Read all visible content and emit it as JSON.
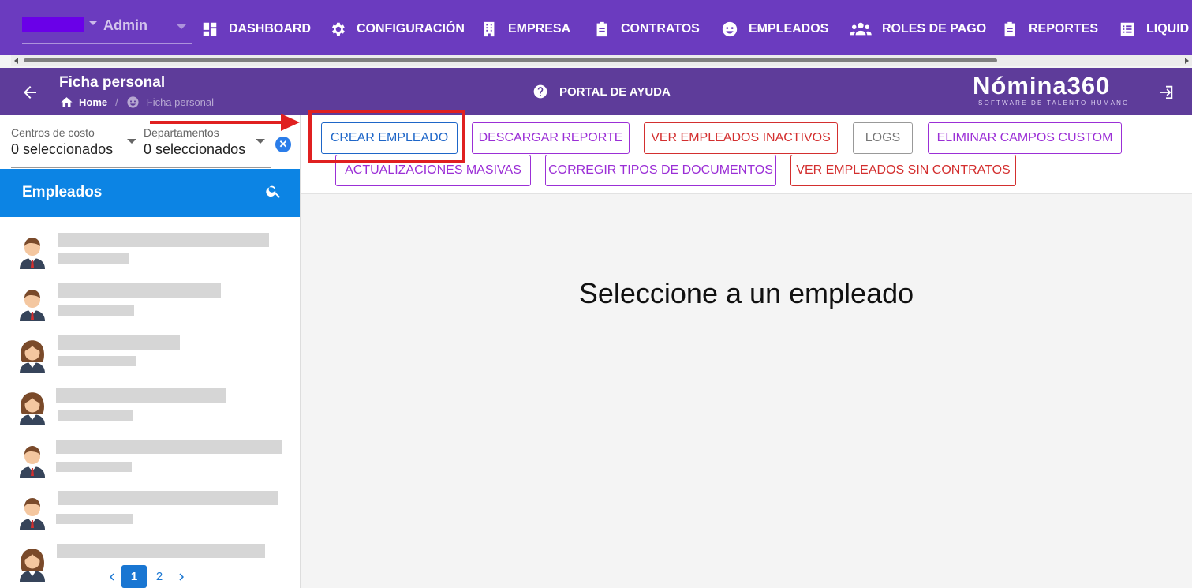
{
  "nav": {
    "company_name": "Admin",
    "items": [
      {
        "label": "DASHBOARD",
        "icon": "dashboard-icon"
      },
      {
        "label": "CONFIGURACIÓN",
        "icon": "gear-icon"
      },
      {
        "label": "EMPRESA",
        "icon": "building-icon"
      },
      {
        "label": "CONTRATOS",
        "icon": "clipboard-icon"
      },
      {
        "label": "EMPLEADOS",
        "icon": "face-icon"
      },
      {
        "label": "ROLES DE PAGO",
        "icon": "people-icon"
      },
      {
        "label": "REPORTES",
        "icon": "clipboard-list-icon"
      },
      {
        "label": "LIQUID",
        "icon": "list-icon"
      }
    ]
  },
  "subheader": {
    "title": "Ficha personal",
    "breadcrumb_home": "Home",
    "breadcrumb_separator": "/",
    "breadcrumb_current": "Ficha personal",
    "help_label": "PORTAL DE AYUDA",
    "logo_main": "Nómina360",
    "logo_sub": "SOFTWARE DE TALENTO HUMANO"
  },
  "filters": {
    "cost_center_label": "Centros de costo",
    "cost_center_value": "0 seleccionados",
    "department_label": "Departamentos",
    "department_value": "0 seleccionados",
    "clear_symbol": "✕"
  },
  "employees": {
    "title": "Empleados",
    "pagination": {
      "pages": [
        "1",
        "2"
      ],
      "current": "1"
    }
  },
  "toolbar": {
    "buttons": [
      {
        "label": "CREAR EMPLEADO",
        "style": "blue"
      },
      {
        "label": "DESCARGAR REPORTE",
        "style": "purple"
      },
      {
        "label": "VER EMPLEADOS INACTIVOS",
        "style": "red"
      },
      {
        "label": "LOGS",
        "style": "grey"
      },
      {
        "label": "ELIMINAR CAMPOS CUSTOM",
        "style": "purple"
      },
      {
        "label": "ACTUALIZACIONES MASIVAS",
        "style": "purple"
      },
      {
        "label": "CORREGIR TIPOS DE DOCUMENTOS",
        "style": "purple"
      },
      {
        "label": "VER EMPLEADOS SIN CONTRATOS",
        "style": "red"
      }
    ]
  },
  "main": {
    "empty_message": "Seleccione a un empleado"
  },
  "colors": {
    "topnav": "#6b3bbf",
    "subheader": "#5e3c9a",
    "employees_header": "#0c84e4",
    "annotation": "#e02020"
  }
}
